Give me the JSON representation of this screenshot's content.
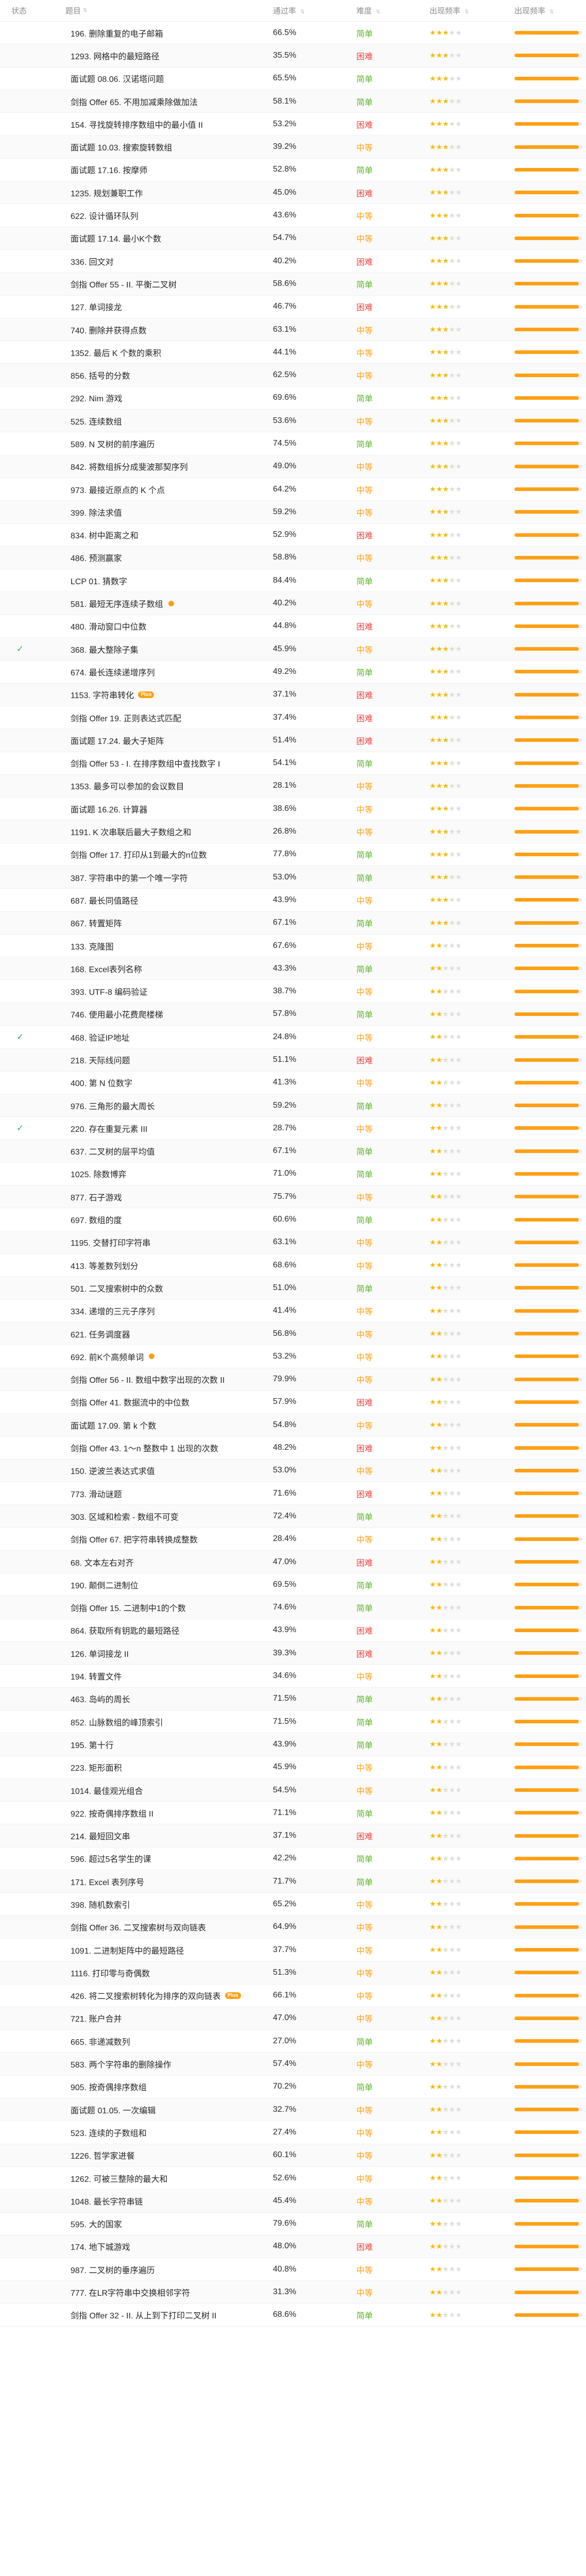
{
  "header": {
    "status": "状态",
    "title": "题目",
    "acceptance": "通过率",
    "difficulty": "难度",
    "frequency": "出现频率",
    "progress": "出现频率"
  },
  "difficulty_colors": {
    "简单": "#5ab726",
    "中等": "#ffa116",
    "困难": "#ef4743"
  },
  "rows": [
    {
      "title": "196. 删除重复的电子邮箱",
      "acc": "66.5%",
      "diff": "简单",
      "stars": 3,
      "bar": 0.95
    },
    {
      "title": "1293. 网格中的最短路径",
      "acc": "35.5%",
      "diff": "困难",
      "stars": 3,
      "bar": 0.95
    },
    {
      "title": "面试题 08.06. 汉诺塔问题",
      "acc": "65.5%",
      "diff": "简单",
      "stars": 3,
      "bar": 0.95
    },
    {
      "title": "剑指 Offer 65. 不用加减乘除做加法",
      "acc": "58.1%",
      "diff": "简单",
      "stars": 3,
      "bar": 0.95
    },
    {
      "title": "154. 寻找旋转排序数组中的最小值 II",
      "acc": "53.2%",
      "diff": "困难",
      "stars": 3,
      "bar": 0.95
    },
    {
      "title": "面试题 10.03. 搜索旋转数组",
      "acc": "39.2%",
      "diff": "中等",
      "stars": 3,
      "bar": 0.95
    },
    {
      "title": "面试题 17.16. 按摩师",
      "acc": "52.8%",
      "diff": "简单",
      "stars": 3,
      "bar": 0.95
    },
    {
      "title": "1235. 规划兼职工作",
      "acc": "45.0%",
      "diff": "困难",
      "stars": 3,
      "bar": 0.95
    },
    {
      "title": "622. 设计循环队列",
      "acc": "43.6%",
      "diff": "中等",
      "stars": 3,
      "bar": 0.95
    },
    {
      "title": "面试题 17.14. 最小K个数",
      "acc": "54.7%",
      "diff": "中等",
      "stars": 3,
      "bar": 0.95
    },
    {
      "title": "336. 回文对",
      "acc": "40.2%",
      "diff": "困难",
      "stars": 3,
      "bar": 0.95
    },
    {
      "title": "剑指 Offer 55 - II. 平衡二叉树",
      "acc": "58.6%",
      "diff": "简单",
      "stars": 3,
      "bar": 0.95
    },
    {
      "title": "127. 单词接龙",
      "acc": "46.7%",
      "diff": "困难",
      "stars": 3,
      "bar": 0.95
    },
    {
      "title": "740. 删除并获得点数",
      "acc": "63.1%",
      "diff": "中等",
      "stars": 3,
      "bar": 0.95
    },
    {
      "title": "1352. 最后 K 个数的乘积",
      "acc": "44.1%",
      "diff": "中等",
      "stars": 3,
      "bar": 0.95
    },
    {
      "title": "856. 括号的分数",
      "acc": "62.5%",
      "diff": "中等",
      "stars": 3,
      "bar": 0.95
    },
    {
      "title": "292. Nim 游戏",
      "acc": "69.6%",
      "diff": "简单",
      "stars": 3,
      "bar": 0.95
    },
    {
      "title": "525. 连续数组",
      "acc": "53.6%",
      "diff": "中等",
      "stars": 3,
      "bar": 0.95
    },
    {
      "title": "589. N 叉树的前序遍历",
      "acc": "74.5%",
      "diff": "简单",
      "stars": 3,
      "bar": 0.95
    },
    {
      "title": "842. 将数组拆分成斐波那契序列",
      "acc": "49.0%",
      "diff": "中等",
      "stars": 3,
      "bar": 0.95
    },
    {
      "title": "973. 最接近原点的 K 个点",
      "acc": "64.2%",
      "diff": "中等",
      "stars": 3,
      "bar": 0.95
    },
    {
      "title": "399. 除法求值",
      "acc": "59.2%",
      "diff": "中等",
      "stars": 3,
      "bar": 0.95
    },
    {
      "title": "834. 树中距离之和",
      "acc": "52.9%",
      "diff": "困难",
      "stars": 3,
      "bar": 0.95
    },
    {
      "title": "486. 预测赢家",
      "acc": "58.8%",
      "diff": "中等",
      "stars": 3,
      "bar": 0.95
    },
    {
      "title": "LCP 01. 猜数字",
      "acc": "84.4%",
      "diff": "简单",
      "stars": 3,
      "bar": 0.95
    },
    {
      "title": "581. 最短无序连续子数组",
      "acc": "40.2%",
      "diff": "中等",
      "stars": 3,
      "bar": 0.95,
      "dot": true
    },
    {
      "title": "480. 滑动窗口中位数",
      "acc": "44.8%",
      "diff": "困难",
      "stars": 3,
      "bar": 0.95
    },
    {
      "title": "368. 最大整除子集",
      "acc": "45.9%",
      "diff": "中等",
      "stars": 3,
      "bar": 0.95,
      "done": true
    },
    {
      "title": "674. 最长连续递增序列",
      "acc": "49.2%",
      "diff": "简单",
      "stars": 3,
      "bar": 0.95
    },
    {
      "title": "1153. 字符串转化",
      "acc": "37.1%",
      "diff": "困难",
      "stars": 3,
      "bar": 0.95,
      "plus": "Plus"
    },
    {
      "title": "剑指 Offer 19. 正则表达式匹配",
      "acc": "37.4%",
      "diff": "困难",
      "stars": 3,
      "bar": 0.95
    },
    {
      "title": "面试题 17.24. 最大子矩阵",
      "acc": "51.4%",
      "diff": "困难",
      "stars": 3,
      "bar": 0.95
    },
    {
      "title": "剑指 Offer 53 - I. 在排序数组中查找数字 I",
      "acc": "54.1%",
      "diff": "简单",
      "stars": 3,
      "bar": 0.95
    },
    {
      "title": "1353. 最多可以参加的会议数目",
      "acc": "28.1%",
      "diff": "中等",
      "stars": 3,
      "bar": 0.95
    },
    {
      "title": "面试题 16.26. 计算器",
      "acc": "38.6%",
      "diff": "中等",
      "stars": 3,
      "bar": 0.95
    },
    {
      "title": "1191. K 次串联后最大子数组之和",
      "acc": "26.8%",
      "diff": "中等",
      "stars": 3,
      "bar": 0.95
    },
    {
      "title": "剑指 Offer 17. 打印从1到最大的n位数",
      "acc": "77.8%",
      "diff": "简单",
      "stars": 3,
      "bar": 0.95
    },
    {
      "title": "387. 字符串中的第一个唯一字符",
      "acc": "53.0%",
      "diff": "简单",
      "stars": 3,
      "bar": 0.95
    },
    {
      "title": "687. 最长同值路径",
      "acc": "43.9%",
      "diff": "中等",
      "stars": 3,
      "bar": 0.95
    },
    {
      "title": "867. 转置矩阵",
      "acc": "67.1%",
      "diff": "简单",
      "stars": 3,
      "bar": 0.95
    },
    {
      "title": "133. 克隆图",
      "acc": "67.6%",
      "diff": "中等",
      "stars": 2,
      "bar": 0.95
    },
    {
      "title": "168. Excel表列名称",
      "acc": "43.3%",
      "diff": "简单",
      "stars": 2,
      "bar": 0.95
    },
    {
      "title": "393. UTF-8 编码验证",
      "acc": "38.7%",
      "diff": "中等",
      "stars": 2,
      "bar": 0.95
    },
    {
      "title": "746. 使用最小花费爬楼梯",
      "acc": "57.8%",
      "diff": "简单",
      "stars": 2,
      "bar": 0.95
    },
    {
      "title": "468. 验证IP地址",
      "acc": "24.8%",
      "diff": "中等",
      "stars": 2,
      "bar": 0.95,
      "done": true
    },
    {
      "title": "218. 天际线问题",
      "acc": "51.1%",
      "diff": "困难",
      "stars": 2,
      "bar": 0.95
    },
    {
      "title": "400. 第 N 位数字",
      "acc": "41.3%",
      "diff": "中等",
      "stars": 2,
      "bar": 0.95
    },
    {
      "title": "976. 三角形的最大周长",
      "acc": "59.2%",
      "diff": "简单",
      "stars": 2,
      "bar": 0.95
    },
    {
      "title": "220. 存在重复元素 III",
      "acc": "28.7%",
      "diff": "中等",
      "stars": 2,
      "bar": 0.95,
      "done": true
    },
    {
      "title": "637. 二叉树的层平均值",
      "acc": "67.1%",
      "diff": "简单",
      "stars": 2,
      "bar": 0.95
    },
    {
      "title": "1025. 除数博弈",
      "acc": "71.0%",
      "diff": "简单",
      "stars": 2,
      "bar": 0.95
    },
    {
      "title": "877. 石子游戏",
      "acc": "75.7%",
      "diff": "中等",
      "stars": 2,
      "bar": 0.95
    },
    {
      "title": "697. 数组的度",
      "acc": "60.6%",
      "diff": "简单",
      "stars": 2,
      "bar": 0.95
    },
    {
      "title": "1195. 交替打印字符串",
      "acc": "63.1%",
      "diff": "中等",
      "stars": 2,
      "bar": 0.95
    },
    {
      "title": "413. 等差数列划分",
      "acc": "68.6%",
      "diff": "中等",
      "stars": 2,
      "bar": 0.95
    },
    {
      "title": "501. 二叉搜索树中的众数",
      "acc": "51.0%",
      "diff": "简单",
      "stars": 2,
      "bar": 0.95
    },
    {
      "title": "334. 递增的三元子序列",
      "acc": "41.4%",
      "diff": "中等",
      "stars": 2,
      "bar": 0.95
    },
    {
      "title": "621. 任务调度器",
      "acc": "56.8%",
      "diff": "中等",
      "stars": 2,
      "bar": 0.95
    },
    {
      "title": "692. 前K个高频单词",
      "acc": "53.2%",
      "diff": "中等",
      "stars": 2,
      "bar": 0.95,
      "dot": true
    },
    {
      "title": "剑指 Offer 56 - II. 数组中数字出现的次数 II",
      "acc": "79.9%",
      "diff": "中等",
      "stars": 2,
      "bar": 0.95
    },
    {
      "title": "剑指 Offer 41. 数据流中的中位数",
      "acc": "57.9%",
      "diff": "困难",
      "stars": 2,
      "bar": 0.95
    },
    {
      "title": "面试题 17.09. 第 k 个数",
      "acc": "54.8%",
      "diff": "中等",
      "stars": 2,
      "bar": 0.95
    },
    {
      "title": "剑指 Offer 43. 1～n 整数中 1 出现的次数",
      "acc": "48.2%",
      "diff": "困难",
      "stars": 2,
      "bar": 0.95
    },
    {
      "title": "150. 逆波兰表达式求值",
      "acc": "53.0%",
      "diff": "中等",
      "stars": 2,
      "bar": 0.95
    },
    {
      "title": "773. 滑动谜题",
      "acc": "71.6%",
      "diff": "困难",
      "stars": 2,
      "bar": 0.95
    },
    {
      "title": "303. 区域和检索 - 数组不可变",
      "acc": "72.4%",
      "diff": "简单",
      "stars": 2,
      "bar": 0.95
    },
    {
      "title": "剑指 Offer 67. 把字符串转换成整数",
      "acc": "28.4%",
      "diff": "中等",
      "stars": 2,
      "bar": 0.95
    },
    {
      "title": "68. 文本左右对齐",
      "acc": "47.0%",
      "diff": "困难",
      "stars": 2,
      "bar": 0.95
    },
    {
      "title": "190. 颠倒二进制位",
      "acc": "69.5%",
      "diff": "简单",
      "stars": 2,
      "bar": 0.95
    },
    {
      "title": "剑指 Offer 15. 二进制中1的个数",
      "acc": "74.6%",
      "diff": "简单",
      "stars": 2,
      "bar": 0.95
    },
    {
      "title": "864. 获取所有钥匙的最短路径",
      "acc": "43.9%",
      "diff": "困难",
      "stars": 2,
      "bar": 0.95
    },
    {
      "title": "126. 单词接龙 II",
      "acc": "39.3%",
      "diff": "困难",
      "stars": 2,
      "bar": 0.95
    },
    {
      "title": "194. 转置文件",
      "acc": "34.6%",
      "diff": "中等",
      "stars": 2,
      "bar": 0.95
    },
    {
      "title": "463. 岛屿的周长",
      "acc": "71.5%",
      "diff": "简单",
      "stars": 2,
      "bar": 0.95
    },
    {
      "title": "852. 山脉数组的峰顶索引",
      "acc": "71.5%",
      "diff": "简单",
      "stars": 2,
      "bar": 0.95
    },
    {
      "title": "195. 第十行",
      "acc": "43.9%",
      "diff": "简单",
      "stars": 2,
      "bar": 0.95
    },
    {
      "title": "223. 矩形面积",
      "acc": "45.9%",
      "diff": "中等",
      "stars": 2,
      "bar": 0.95
    },
    {
      "title": "1014. 最佳观光组合",
      "acc": "54.5%",
      "diff": "中等",
      "stars": 2,
      "bar": 0.95
    },
    {
      "title": "922. 按奇偶排序数组 II",
      "acc": "71.1%",
      "diff": "简单",
      "stars": 2,
      "bar": 0.95
    },
    {
      "title": "214. 最短回文串",
      "acc": "37.1%",
      "diff": "困难",
      "stars": 2,
      "bar": 0.95
    },
    {
      "title": "596. 超过5名学生的课",
      "acc": "42.2%",
      "diff": "简单",
      "stars": 2,
      "bar": 0.95
    },
    {
      "title": "171. Excel 表列序号",
      "acc": "71.7%",
      "diff": "简单",
      "stars": 2,
      "bar": 0.95
    },
    {
      "title": "398. 随机数索引",
      "acc": "65.2%",
      "diff": "中等",
      "stars": 2,
      "bar": 0.95
    },
    {
      "title": "剑指 Offer 36. 二叉搜索树与双向链表",
      "acc": "64.9%",
      "diff": "中等",
      "stars": 2,
      "bar": 0.95
    },
    {
      "title": "1091. 二进制矩阵中的最短路径",
      "acc": "37.7%",
      "diff": "中等",
      "stars": 2,
      "bar": 0.95
    },
    {
      "title": "1116. 打印零与奇偶数",
      "acc": "51.3%",
      "diff": "中等",
      "stars": 2,
      "bar": 0.95
    },
    {
      "title": "426. 将二叉搜索树转化为排序的双向链表",
      "acc": "66.1%",
      "diff": "中等",
      "stars": 2,
      "bar": 0.95,
      "plus": "Plus"
    },
    {
      "title": "721. 账户合并",
      "acc": "47.0%",
      "diff": "中等",
      "stars": 2,
      "bar": 0.95
    },
    {
      "title": "665. 非递减数列",
      "acc": "27.0%",
      "diff": "简单",
      "stars": 2,
      "bar": 0.95
    },
    {
      "title": "583. 两个字符串的删除操作",
      "acc": "57.4%",
      "diff": "中等",
      "stars": 2,
      "bar": 0.95
    },
    {
      "title": "905. 按奇偶排序数组",
      "acc": "70.2%",
      "diff": "简单",
      "stars": 2,
      "bar": 0.95
    },
    {
      "title": "面试题 01.05. 一次编辑",
      "acc": "32.7%",
      "diff": "中等",
      "stars": 2,
      "bar": 0.95
    },
    {
      "title": "523. 连续的子数组和",
      "acc": "27.4%",
      "diff": "中等",
      "stars": 2,
      "bar": 0.95
    },
    {
      "title": "1226. 哲学家进餐",
      "acc": "60.1%",
      "diff": "中等",
      "stars": 2,
      "bar": 0.95
    },
    {
      "title": "1262. 可被三整除的最大和",
      "acc": "52.6%",
      "diff": "中等",
      "stars": 2,
      "bar": 0.95
    },
    {
      "title": "1048. 最长字符串链",
      "acc": "45.4%",
      "diff": "中等",
      "stars": 2,
      "bar": 0.95
    },
    {
      "title": "595. 大的国家",
      "acc": "79.6%",
      "diff": "简单",
      "stars": 2,
      "bar": 0.95
    },
    {
      "title": "174. 地下城游戏",
      "acc": "48.0%",
      "diff": "困难",
      "stars": 2,
      "bar": 0.95
    },
    {
      "title": "987. 二叉树的垂序遍历",
      "acc": "40.8%",
      "diff": "中等",
      "stars": 2,
      "bar": 0.95
    },
    {
      "title": "777. 在LR字符串中交换相邻字符",
      "acc": "31.3%",
      "diff": "中等",
      "stars": 2,
      "bar": 0.95
    },
    {
      "title": "剑指 Offer 32 - II. 从上到下打印二叉树 II",
      "acc": "68.6%",
      "diff": "简单",
      "stars": 2,
      "bar": 0.95
    }
  ]
}
